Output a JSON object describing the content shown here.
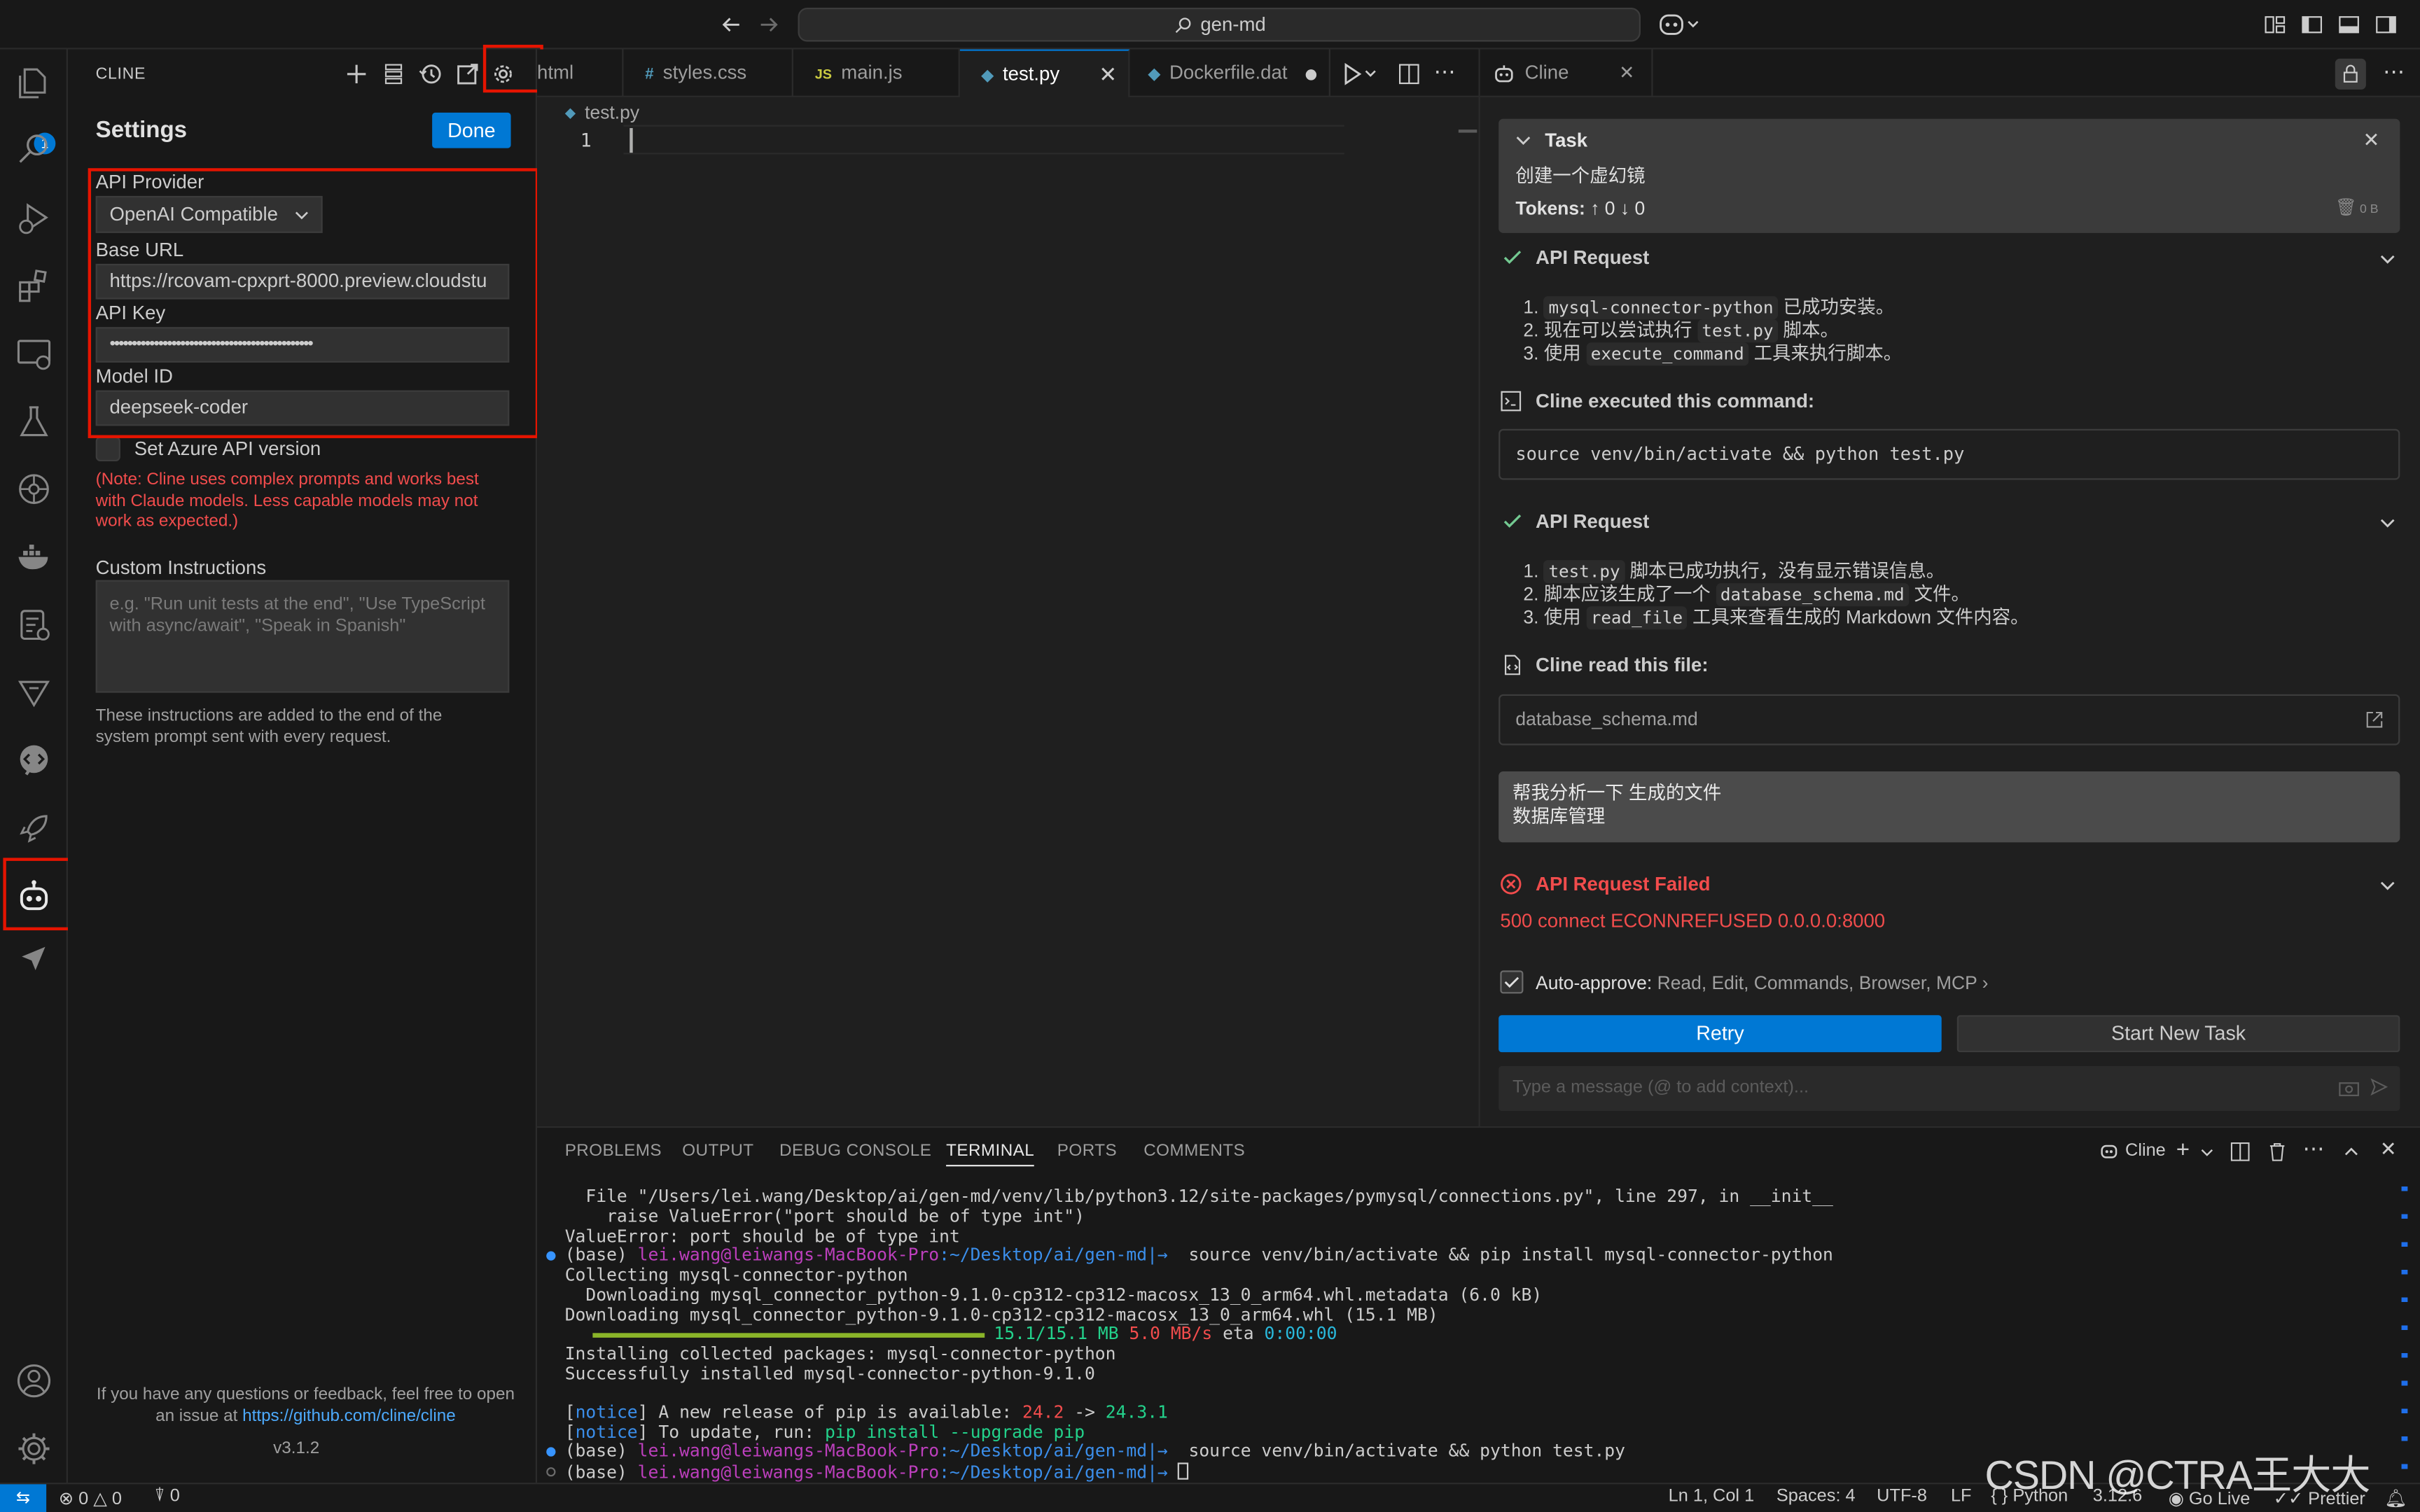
{
  "titlebar": {
    "search_text": "gen-md"
  },
  "activity": {
    "explorer_badge": "1"
  },
  "sidebar": {
    "title": "CLINE",
    "settings_title": "Settings",
    "done_label": "Done",
    "api_provider_label": "API Provider",
    "api_provider_value": "OpenAI Compatible",
    "base_url_label": "Base URL",
    "base_url_value": "https://rcovam-cpxprt-8000.preview.cloudstu",
    "api_key_label": "API Key",
    "api_key_value": "••••••••••••••••••••••••••••••••••••••••••••••",
    "model_id_label": "Model ID",
    "model_id_value": "deepseek-coder",
    "azure_label": "Set Azure API version",
    "note": "(Note: Cline uses complex prompts and works best with Claude models. Less capable models may not work as expected.)",
    "custom_label": "Custom Instructions",
    "custom_placeholder": "e.g. \"Run unit tests at the end\", \"Use TypeScript with async/await\", \"Speak in Spanish\"",
    "custom_help": "These instructions are added to the end of the system prompt sent with every request.",
    "feedback_text": "If you have any questions or feedback, feel free to open an issue at",
    "feedback_link": "https://github.com/cline/cline",
    "version": "v3.1.2"
  },
  "tabs": [
    {
      "label": "html",
      "icon": "<"
    },
    {
      "label": "styles.css",
      "icon": "#"
    },
    {
      "label": "main.js",
      "icon": "JS"
    },
    {
      "label": "test.py",
      "icon": "py"
    },
    {
      "label": "Dockerfile.dat",
      "icon": "docker"
    }
  ],
  "editor": {
    "breadcrumb": "test.py",
    "line_number": "1"
  },
  "cline": {
    "tab_label": "Cline",
    "task_label": "Task",
    "task_text": "创建一个虚幻镜",
    "tokens_label": "Tokens:",
    "tokens_up": "0",
    "tokens_down": "0",
    "cache_size": "0 B",
    "api_request_label": "API Request",
    "req1": {
      "i1_code": "mysql-connector-python",
      "i1_text": " 已成功安装。",
      "i2_text": "现在可以尝试执行 ",
      "i2_code": "test.py",
      "i2_tail": " 脚本。",
      "i3_text": "使用 ",
      "i3_code": "execute_command",
      "i3_tail": " 工具来执行脚本。"
    },
    "executed_label": "Cline executed this command:",
    "command": "source venv/bin/activate && python test.py",
    "req2": {
      "i1_code": "test.py",
      "i1_text": " 脚本已成功执行，没有显示错误信息。",
      "i2_text": "脚本应该生成了一个 ",
      "i2_code": "database_schema.md",
      "i2_tail": " 文件。",
      "i3_text": "使用 ",
      "i3_code": "read_file",
      "i3_tail": " 工具来查看生成的 Markdown 文件内容。"
    },
    "read_label": "Cline read this file:",
    "file_name": "database_schema.md",
    "user_msg_line1": "帮我分析一下 生成的文件",
    "user_msg_line2": "数据库管理",
    "failed_label": "API Request Failed",
    "error_text": "500 connect ECONNREFUSED 0.0.0.0:8000",
    "auto_approve_label": "Auto-approve:",
    "auto_approve_items": "Read, Edit, Commands, Browser, MCP",
    "retry_label": "Retry",
    "new_task_label": "Start New Task",
    "input_placeholder": "Type a message (@ to add context)..."
  },
  "panel": {
    "tabs": [
      "PROBLEMS",
      "OUTPUT",
      "DEBUG CONSOLE",
      "TERMINAL",
      "PORTS",
      "COMMENTS"
    ],
    "terminal_name": "Cline",
    "lines": {
      "l1": "  File \"/Users/lei.wang/Desktop/ai/gen-md/venv/lib/python3.12/site-packages/pymysql/connections.py\", line 297, in __init__",
      "l2": "    raise ValueError(\"port should be of type int\")",
      "l3": "ValueError: port should be of type int",
      "prompt_base": "(base) ",
      "prompt_user": "lei.wang@leiwangs-MacBook-Pro",
      "prompt_path": ":~/Desktop/ai/gen-md",
      "prompt_sep": "|→ ",
      "cmd1": " source venv/bin/activate && pip install mysql-connector-python",
      "l5": "Collecting mysql-connector-python",
      "l6": "  Downloading mysql_connector_python-9.1.0-cp312-cp312-macosx_13_0_arm64.whl.metadata (6.0 kB)",
      "l7": "Downloading mysql_connector_python-9.1.0-cp312-cp312-macosx_13_0_arm64.whl (15.1 MB)",
      "l8_size": "15.1/15.1 MB",
      "l8_speed": "5.0 MB/s",
      "l8_eta": "eta",
      "l8_time": "0:00:00",
      "l9": "Installing collected packages: mysql-connector-python",
      "l10": "Successfully installed mysql-connector-python-9.1.0",
      "notice": "notice",
      "n1_text": " A new release of pip is available: ",
      "n1_old": "24.2",
      "n1_arrow": " -> ",
      "n1_new": "24.3.1",
      "n2_text": " To update, run: ",
      "n2_cmd": "pip install --upgrade pip",
      "cmd2": " source venv/bin/activate && python test.py"
    }
  },
  "status": {
    "errors": "0",
    "warnings": "0",
    "ports": "0",
    "position": "Ln 1, Col 1",
    "spaces": "Spaces: 4",
    "encoding": "UTF-8",
    "eol": "LF",
    "language": "Python",
    "py_version": "3.12.6",
    "golive": "Go Live",
    "prettier": "Prettier"
  },
  "watermark": "CSDN @CTRA王大大",
  "colors": {
    "accent": "#0078d4",
    "error": "#f14c4c",
    "highlight_box": "#e51400",
    "success": "#73c991"
  }
}
